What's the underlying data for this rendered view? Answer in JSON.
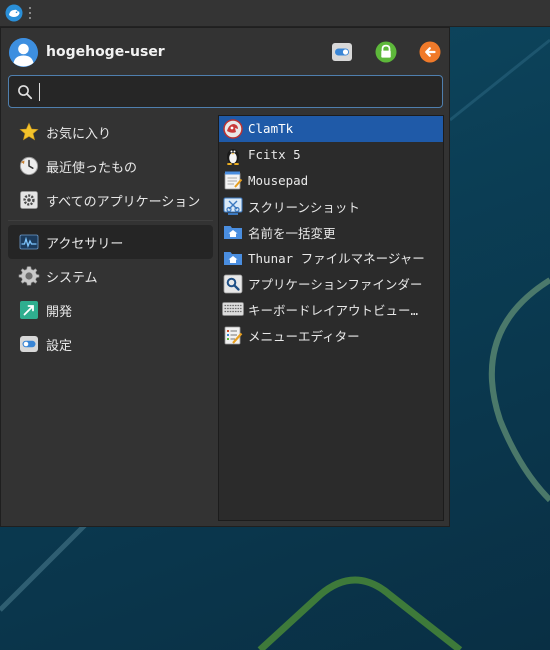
{
  "panel": {
    "menu_icon": "whisker-menu-icon"
  },
  "user": {
    "name": "hogehoge-user"
  },
  "header_actions": [
    {
      "name": "settings-toggle-icon"
    },
    {
      "name": "lock-icon"
    },
    {
      "name": "logout-arrow-icon"
    }
  ],
  "search": {
    "value": "",
    "placeholder": ""
  },
  "categories": [
    {
      "label": "お気に入り",
      "icon": "star-icon"
    },
    {
      "label": "最近使ったもの",
      "icon": "recent-clock-icon"
    },
    {
      "label": "すべてのアプリケーション",
      "icon": "all-apps-icon"
    },
    {
      "label": "アクセサリー",
      "icon": "accessories-icon"
    },
    {
      "label": "システム",
      "icon": "gear-icon"
    },
    {
      "label": "開発",
      "icon": "development-icon"
    },
    {
      "label": "設定",
      "icon": "settings-toggle-icon"
    }
  ],
  "active_category": "アクセサリー",
  "apps": [
    {
      "label": "ClamTk",
      "icon": "clamtk-icon"
    },
    {
      "label": "Fcitx 5",
      "icon": "penguin-icon"
    },
    {
      "label": "Mousepad",
      "icon": "text-editor-icon"
    },
    {
      "label": "スクリーンショット",
      "icon": "screenshot-icon"
    },
    {
      "label": "名前を一括変更",
      "icon": "folder-icon"
    },
    {
      "label": "Thunar ファイルマネージャー",
      "icon": "folder-icon"
    },
    {
      "label": "アプリケーションファインダー",
      "icon": "app-finder-icon"
    },
    {
      "label": "キーボードレイアウトビュー…",
      "icon": "keyboard-icon"
    },
    {
      "label": "メニューエディター",
      "icon": "menu-editor-icon"
    }
  ],
  "selected_app": "ClamTk",
  "colors": {
    "selection": "#1f5aa8",
    "search_border": "#4f7fae",
    "menu_bg": "#333333",
    "list_bg": "#2b2b2b"
  }
}
